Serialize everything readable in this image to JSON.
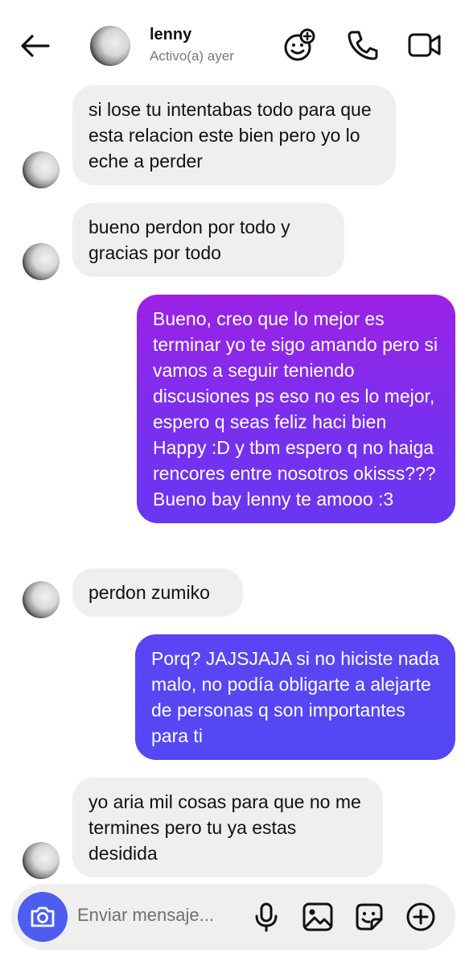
{
  "header": {
    "name": "lenny",
    "status": "Activo(a) ayer"
  },
  "messages": [
    {
      "direction": "incoming",
      "text": "si lose tu intentabas todo para que esta relacion este bien pero yo lo eche a perder"
    },
    {
      "direction": "incoming",
      "text": "bueno perdon por todo y gracias por todo"
    },
    {
      "direction": "outgoing",
      "text": "Bueno, creo que lo mejor es terminar yo te sigo amando pero si vamos a seguir teniendo discusiones ps eso no es lo mejor, espero q seas feliz haci bien Happy :D y tbm espero q no haiga rencores entre nosotros okisss??? Bueno bay lenny te amooo :3"
    },
    {
      "direction": "incoming",
      "text": "perdon zumiko"
    },
    {
      "direction": "outgoing",
      "text": "Porq? JAJSJAJA si no hiciste nada malo, no podía obligarte a alejarte de personas q son importantes para ti"
    },
    {
      "direction": "incoming",
      "text": "yo aria mil cosas para que no me termines pero tu ya estas desidida"
    }
  ],
  "composer": {
    "placeholder": "Enviar mensaje..."
  },
  "icons": {
    "back": "arrow-left-icon",
    "effects": "face-sparkle-icon",
    "call": "phone-icon",
    "video": "video-camera-icon",
    "camera": "camera-icon",
    "mic": "microphone-icon",
    "gallery": "image-icon",
    "sticker": "sticker-icon",
    "add": "plus-circle-icon"
  },
  "colors": {
    "outgoing_top": "#9b22e6",
    "outgoing_bottom": "#5348f5",
    "incoming_bg": "#efefef",
    "camera_button": "#4c5df0"
  }
}
